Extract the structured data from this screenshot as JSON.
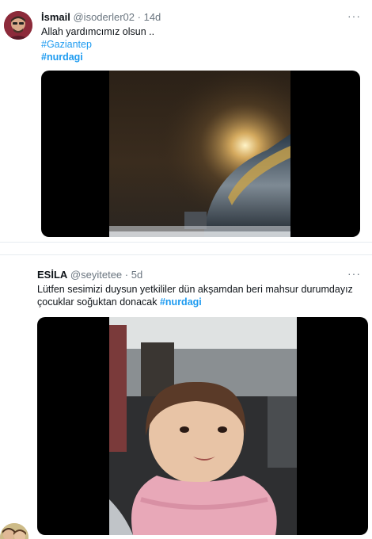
{
  "tweets": [
    {
      "name": "İsmail",
      "handle": "@isoderler02",
      "separator": "·",
      "time": "14d",
      "more": "···",
      "text_line1": "Allah yardımcımız olsun ..",
      "hashtag1": "#Gaziantep",
      "hashtag2": "#nurdagi"
    },
    {
      "name": "ESİLA",
      "handle": "@seyitetee",
      "separator": "·",
      "time": "5d",
      "more": "···",
      "text_line1": "Lütfen sesimizi duysun yetkililer dün akşamdan beri mahsur durumdayız",
      "text_line2": "çocuklar soğuktan donacak",
      "hashtag1": "#nurdagi"
    }
  ],
  "colors": {
    "hashtag": "#1d9bf0",
    "secondary_text": "#6b7680",
    "primary_text": "#0f1419"
  },
  "icons": {
    "more": "more-options-icon"
  }
}
